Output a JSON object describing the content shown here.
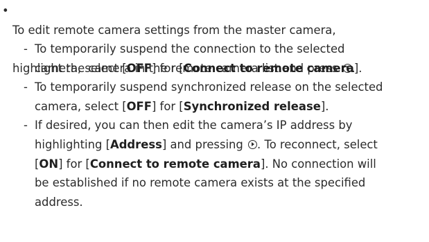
{
  "bullet": {
    "mark": "•",
    "line1": "To edit remote camera settings from the master camera,",
    "line2_pre": "highlight the camera in the remote camera list and press ",
    "line2_post": "."
  },
  "icons": {
    "multi_selector_right": "multi-selector-right-icon"
  },
  "sub_items": [
    {
      "dash": "-",
      "line1": "To temporarily suspend the connection to the selected",
      "line2_pre": "camera, select [",
      "off": "OFF",
      "line2_mid": "] for [",
      "setting": "Connect to remote camera",
      "line2_post": "]."
    },
    {
      "dash": "-",
      "line1": "To temporarily suspend synchronized release on the selected",
      "line2_pre": "camera, select [",
      "off": "OFF",
      "line2_mid": "] for [",
      "setting": "Synchronized release",
      "line2_post": "]."
    },
    {
      "dash": "-",
      "line1": "If desired, you can then edit the camera’s IP address by",
      "line2_pre": "highlighting [",
      "address": "Address",
      "line2_mid": "] and pressing ",
      "line2_post": ". To reconnect, select",
      "line3_pre": "[",
      "on": "ON",
      "line3_mid": "] for [",
      "setting": "Connect to remote camera",
      "line3_post": "]. No connection will",
      "line4": "be established if no remote camera exists at the specified",
      "line5": "address."
    }
  ]
}
